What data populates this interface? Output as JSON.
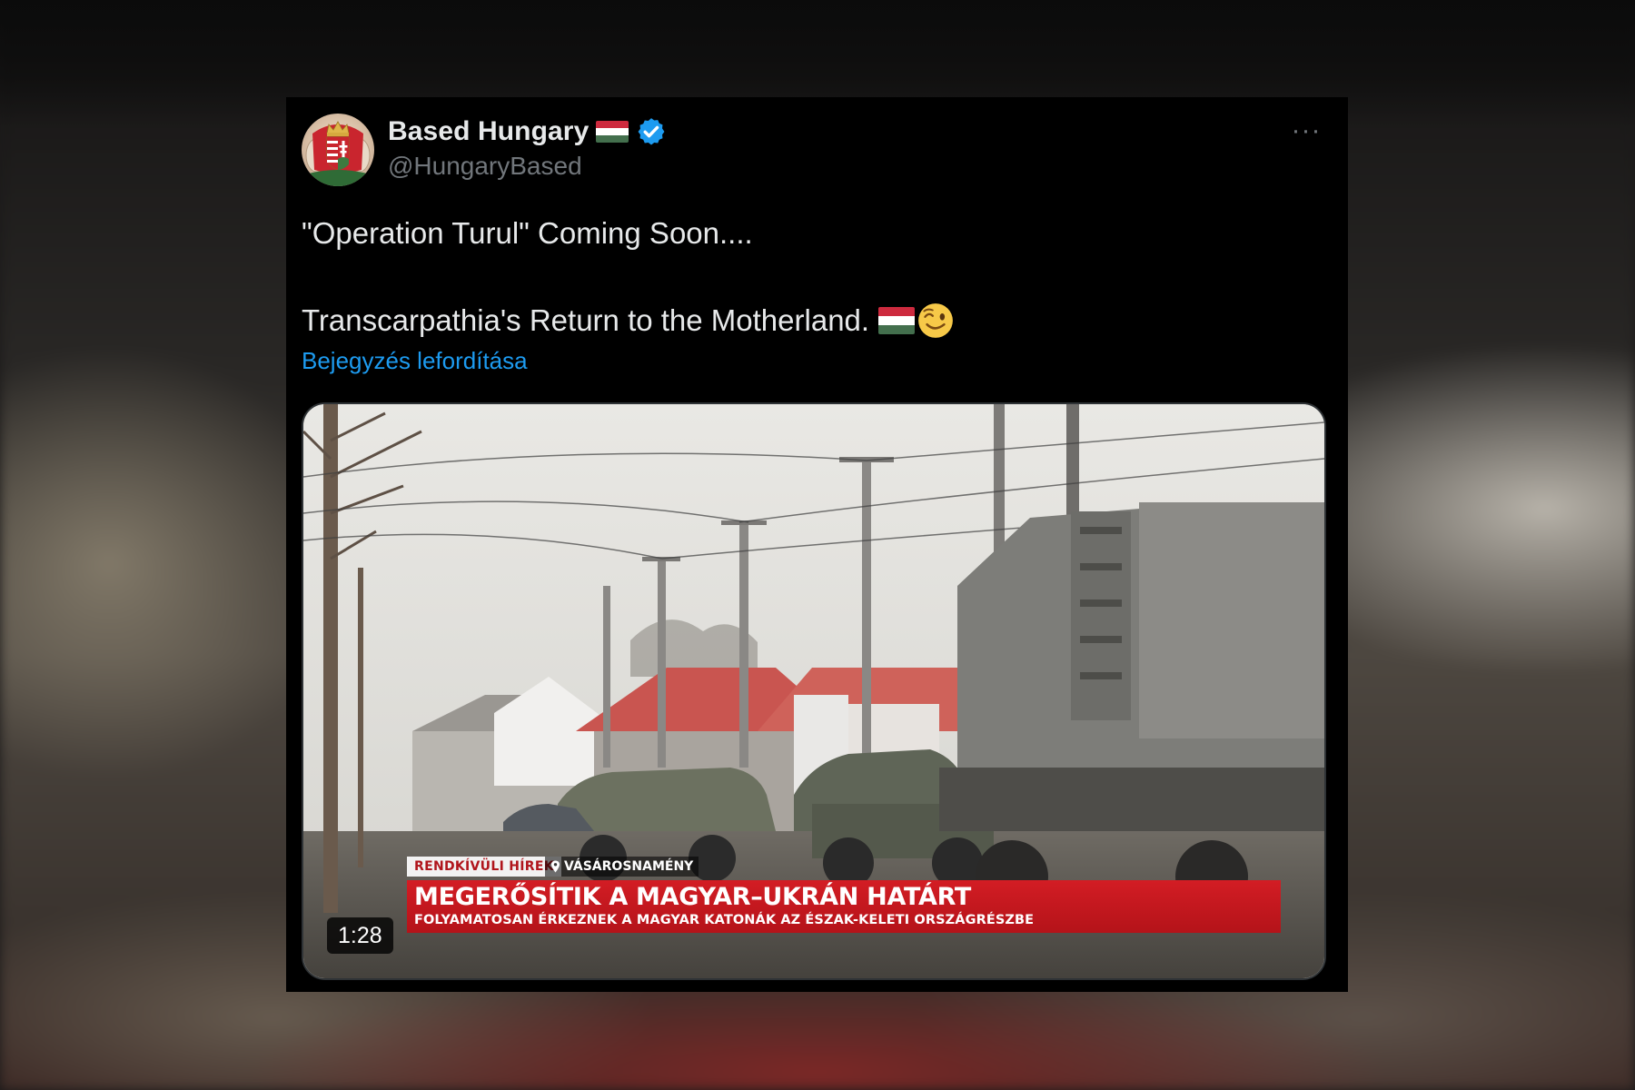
{
  "tweet": {
    "display_name": "Based Hungary",
    "handle": "@HungaryBased",
    "verified": true,
    "text_line_1": "\"Operation Turul\" Coming Soon....",
    "text_line_2": "Transcarpathia's Return to the Motherland.",
    "emojis": [
      "flag-hungary",
      "winking-face"
    ],
    "translate_label": "Bejegyzés lefordítása",
    "more_label": "···"
  },
  "media": {
    "type": "video",
    "duration": "1:28",
    "news_overlay": {
      "breaking_label": "RENDKÍVÜLI HÍREK",
      "location": "VÁSÁROSNAMÉNY",
      "headline": "MEGERŐSÍTIK A MAGYAR–UKRÁN HATÁRT",
      "subheadline": "FOLYAMATOSAN ÉRKEZNEK A MAGYAR KATONÁK AZ ÉSZAK-KELETI ORSZÁGRÉSZBE"
    }
  },
  "colors": {
    "card_background": "#000000",
    "text_primary": "#e7e9ea",
    "text_secondary": "#71767b",
    "link": "#1d9bf0",
    "verified": "#1d9bf0",
    "flag_red": "#cd2a3e",
    "flag_white": "#ffffff",
    "flag_green": "#436f4d",
    "news_red": "#c8171e"
  }
}
